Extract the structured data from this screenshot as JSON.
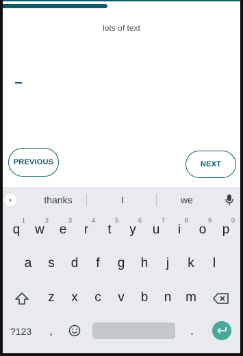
{
  "progress": {
    "value_percent": 44
  },
  "prompt": {
    "text": "lots of text"
  },
  "buttons": {
    "previous": "PREVIOUS",
    "next": "NEXT"
  },
  "keyboard": {
    "suggestions": [
      "thanks",
      "I",
      "we"
    ],
    "row1": [
      {
        "key": "q",
        "num": "1"
      },
      {
        "key": "w",
        "num": "2"
      },
      {
        "key": "e",
        "num": "3"
      },
      {
        "key": "r",
        "num": "4"
      },
      {
        "key": "t",
        "num": "5"
      },
      {
        "key": "y",
        "num": "6"
      },
      {
        "key": "u",
        "num": "7"
      },
      {
        "key": "i",
        "num": "8"
      },
      {
        "key": "o",
        "num": "9"
      },
      {
        "key": "p",
        "num": "0"
      }
    ],
    "row2": [
      "a",
      "s",
      "d",
      "f",
      "g",
      "h",
      "j",
      "k",
      "l"
    ],
    "row3": [
      "z",
      "x",
      "c",
      "v",
      "b",
      "n",
      "m"
    ],
    "symbols_label": "?123",
    "comma": ",",
    "period": "."
  },
  "colors": {
    "accent": "#0d5c63",
    "enter": "#4aa89a",
    "keyboard_bg": "#e8eaed"
  }
}
